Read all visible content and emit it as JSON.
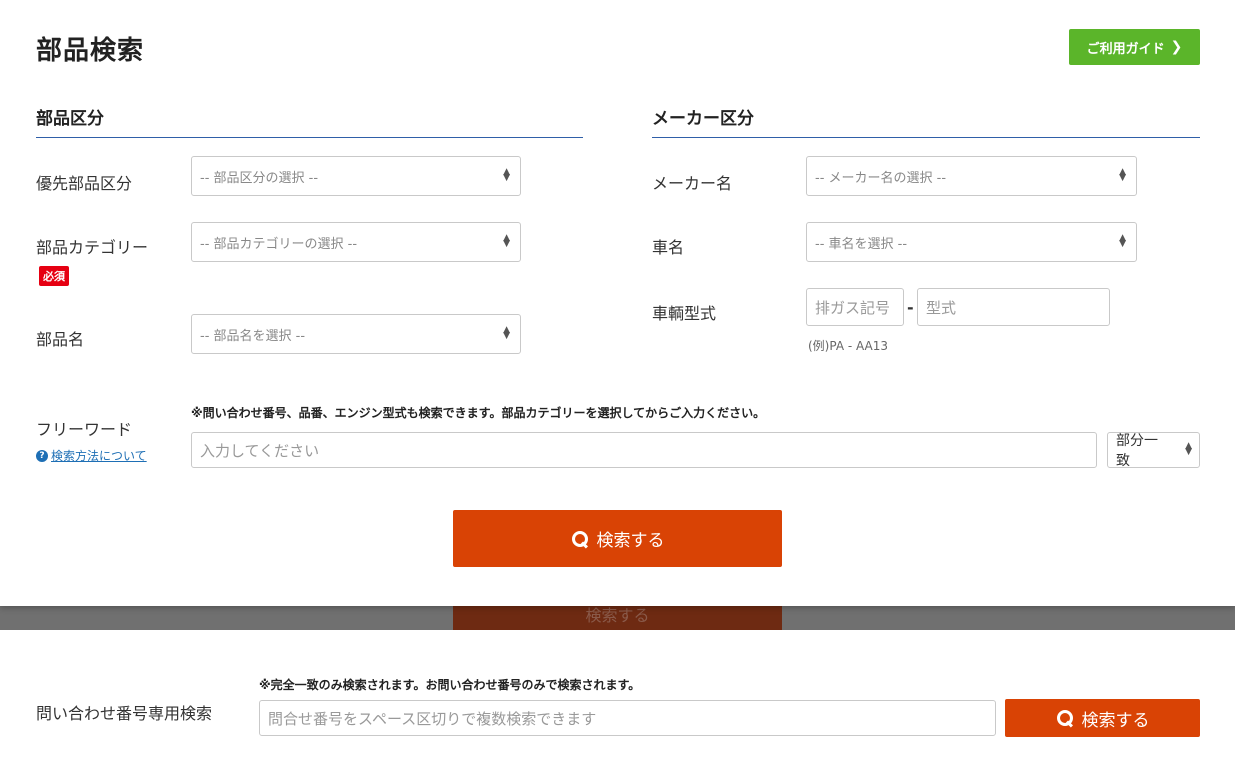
{
  "header": {
    "title": "部品検索",
    "guide_label": "ご利用ガイド",
    "guide_chevron": "❯"
  },
  "parts": {
    "section_title": "部品区分",
    "priority_label": "優先部品区分",
    "priority_placeholder": "-- 部品区分の選択 --",
    "category_label": "部品カテゴリー",
    "required_badge": "必須",
    "category_placeholder": "-- 部品カテゴリーの選択 --",
    "name_label": "部品名",
    "name_placeholder": "-- 部品名を選択 --"
  },
  "maker": {
    "section_title": "メーカー区分",
    "maker_label": "メーカー名",
    "maker_placeholder": "-- メーカー名の選択 --",
    "car_label": "車名",
    "car_placeholder": "-- 車名を選択 --",
    "model_label": "車輌型式",
    "emission_placeholder": "排ガス記号",
    "dash": "-",
    "model_placeholder": "型式",
    "example": "(例)PA - AA13"
  },
  "freeword": {
    "label": "フリーワード",
    "help_link": "検索方法について",
    "help_icon": "?",
    "notice": "※問い合わせ番号、品番、エンジン型式も検索できます。部品カテゴリーを選択してからご入力ください。",
    "placeholder": "入力してください",
    "match_value": "部分一致"
  },
  "search_button": "検索する",
  "inquiry": {
    "label": "問い合わせ番号専用検索",
    "notice": "※完全一致のみ検索されます。お問い合わせ番号のみで検索されます。",
    "placeholder": "問合せ番号をスペース区切りで複数検索できます",
    "button": "検索する"
  },
  "colors": {
    "accent_button": "#d94305",
    "guide_button": "#5bb52a",
    "section_rule": "#2f5fa8",
    "required": "#e60012",
    "link": "#1e6fb5"
  }
}
